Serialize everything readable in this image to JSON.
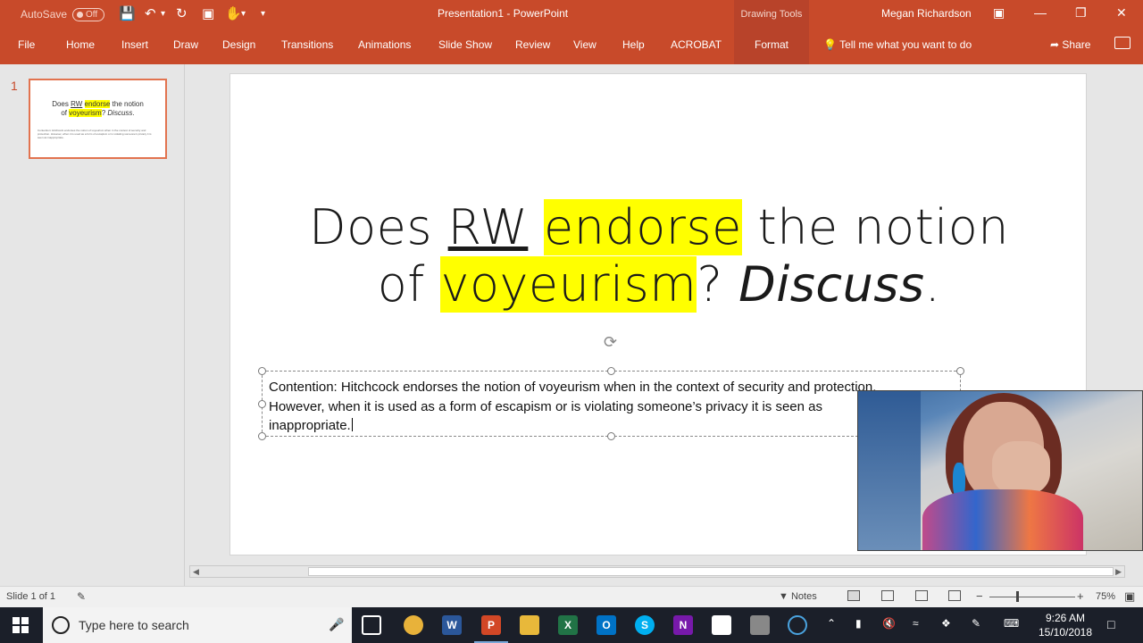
{
  "titlebar": {
    "autosave_label": "AutoSave",
    "autosave_state": "Off",
    "document_title": "Presentation1  -  PowerPoint",
    "contextual_group": "Drawing Tools",
    "user_name": "Megan Richardson"
  },
  "ribbon": {
    "tabs": [
      "File",
      "Home",
      "Insert",
      "Draw",
      "Design",
      "Transitions",
      "Animations",
      "Slide Show",
      "Review",
      "View",
      "Help",
      "ACROBAT"
    ],
    "active_contextual_tab": "Format",
    "tell_me": "Tell me what you want to do",
    "share": "Share"
  },
  "thumbnails": {
    "slide_number": "1"
  },
  "slide": {
    "title_line1_pre": "Does ",
    "title_rw": "RW",
    "title_space": " ",
    "title_endorse": "endorse",
    "title_line1_post": " the notion",
    "title_line2_pre": "of ",
    "title_voyeurism": "voyeurism",
    "title_q": "? ",
    "title_discuss": "Discuss",
    "title_period": ".",
    "body_line1": "Contention: Hitchcock endorses the notion of voyeurism when in the context of security and protection.",
    "body_line2": "However, when it is used as a form of escapism or is violating someone’s privacy it is seen as",
    "body_line3": "inappropriate."
  },
  "thumbnail_body": "Contention: Hitchcock endorses the notion of voyeurism when in the context of security and protection. However, when it is used as a form of escapism or is violating someone's privacy it is seen as inappropriate.",
  "statusbar": {
    "slide_count": "Slide 1 of 1",
    "notes": "Notes",
    "zoom": "75%"
  },
  "taskbar": {
    "search_placeholder": "Type here to search",
    "time": "9:26 AM",
    "date": "15/10/2018"
  },
  "colors": {
    "accent": "#c84a2a",
    "highlight": "#ffff00"
  }
}
